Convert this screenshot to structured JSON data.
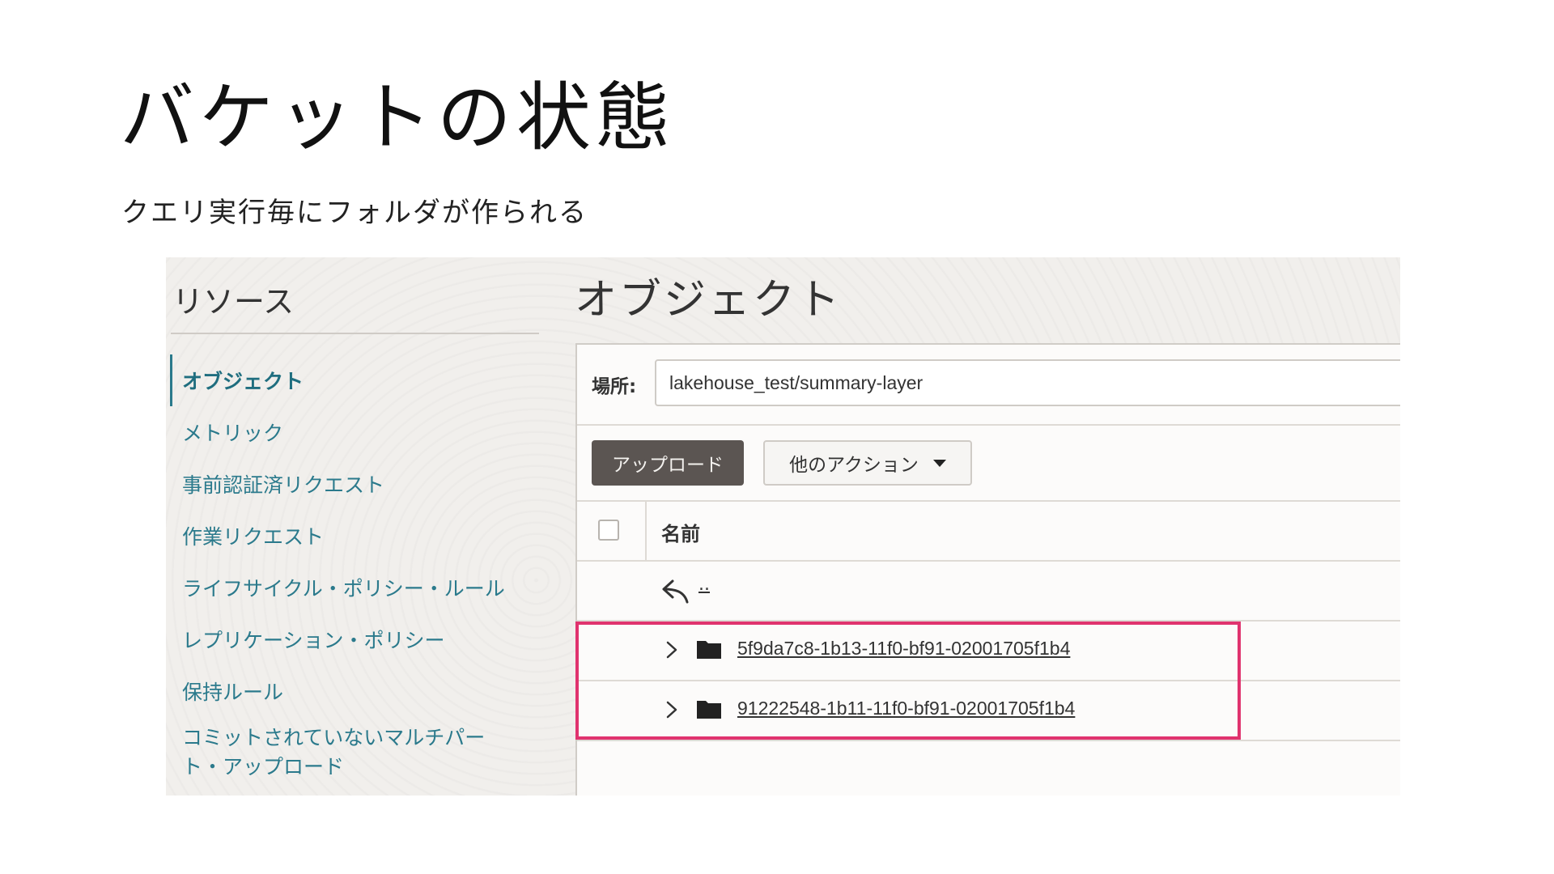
{
  "slide": {
    "title": "バケットの状態",
    "subtitle": "クエリ実行毎にフォルダが作られる"
  },
  "sidebar": {
    "heading": "リソース",
    "items": [
      {
        "label": "オブジェクト"
      },
      {
        "label": "メトリック"
      },
      {
        "label": "事前認証済リクエスト"
      },
      {
        "label": "作業リクエスト"
      },
      {
        "label": "ライフサイクル・ポリシー・ルール"
      },
      {
        "label": "レプリケーション・ポリシー"
      },
      {
        "label": "保持ルール"
      },
      {
        "label": "コミットされていないマルチパート・アップロード"
      }
    ]
  },
  "main": {
    "title": "オブジェクト",
    "location_label": "場所:",
    "location_value": "lakehouse_test/summary-layer",
    "upload_label": "アップロード",
    "more_actions_label": "他のアクション",
    "name_column_header": "名前",
    "parent_link": "..",
    "folders": [
      {
        "name": "5f9da7c8-1b13-11f0-bf91-02001705f1b4"
      },
      {
        "name": "91222548-1b11-11f0-bf91-02001705f1b4"
      }
    ]
  },
  "colors": {
    "link_teal": "#2b7a8c",
    "highlight": "#e0336e",
    "primary_button": "#5b5552"
  }
}
